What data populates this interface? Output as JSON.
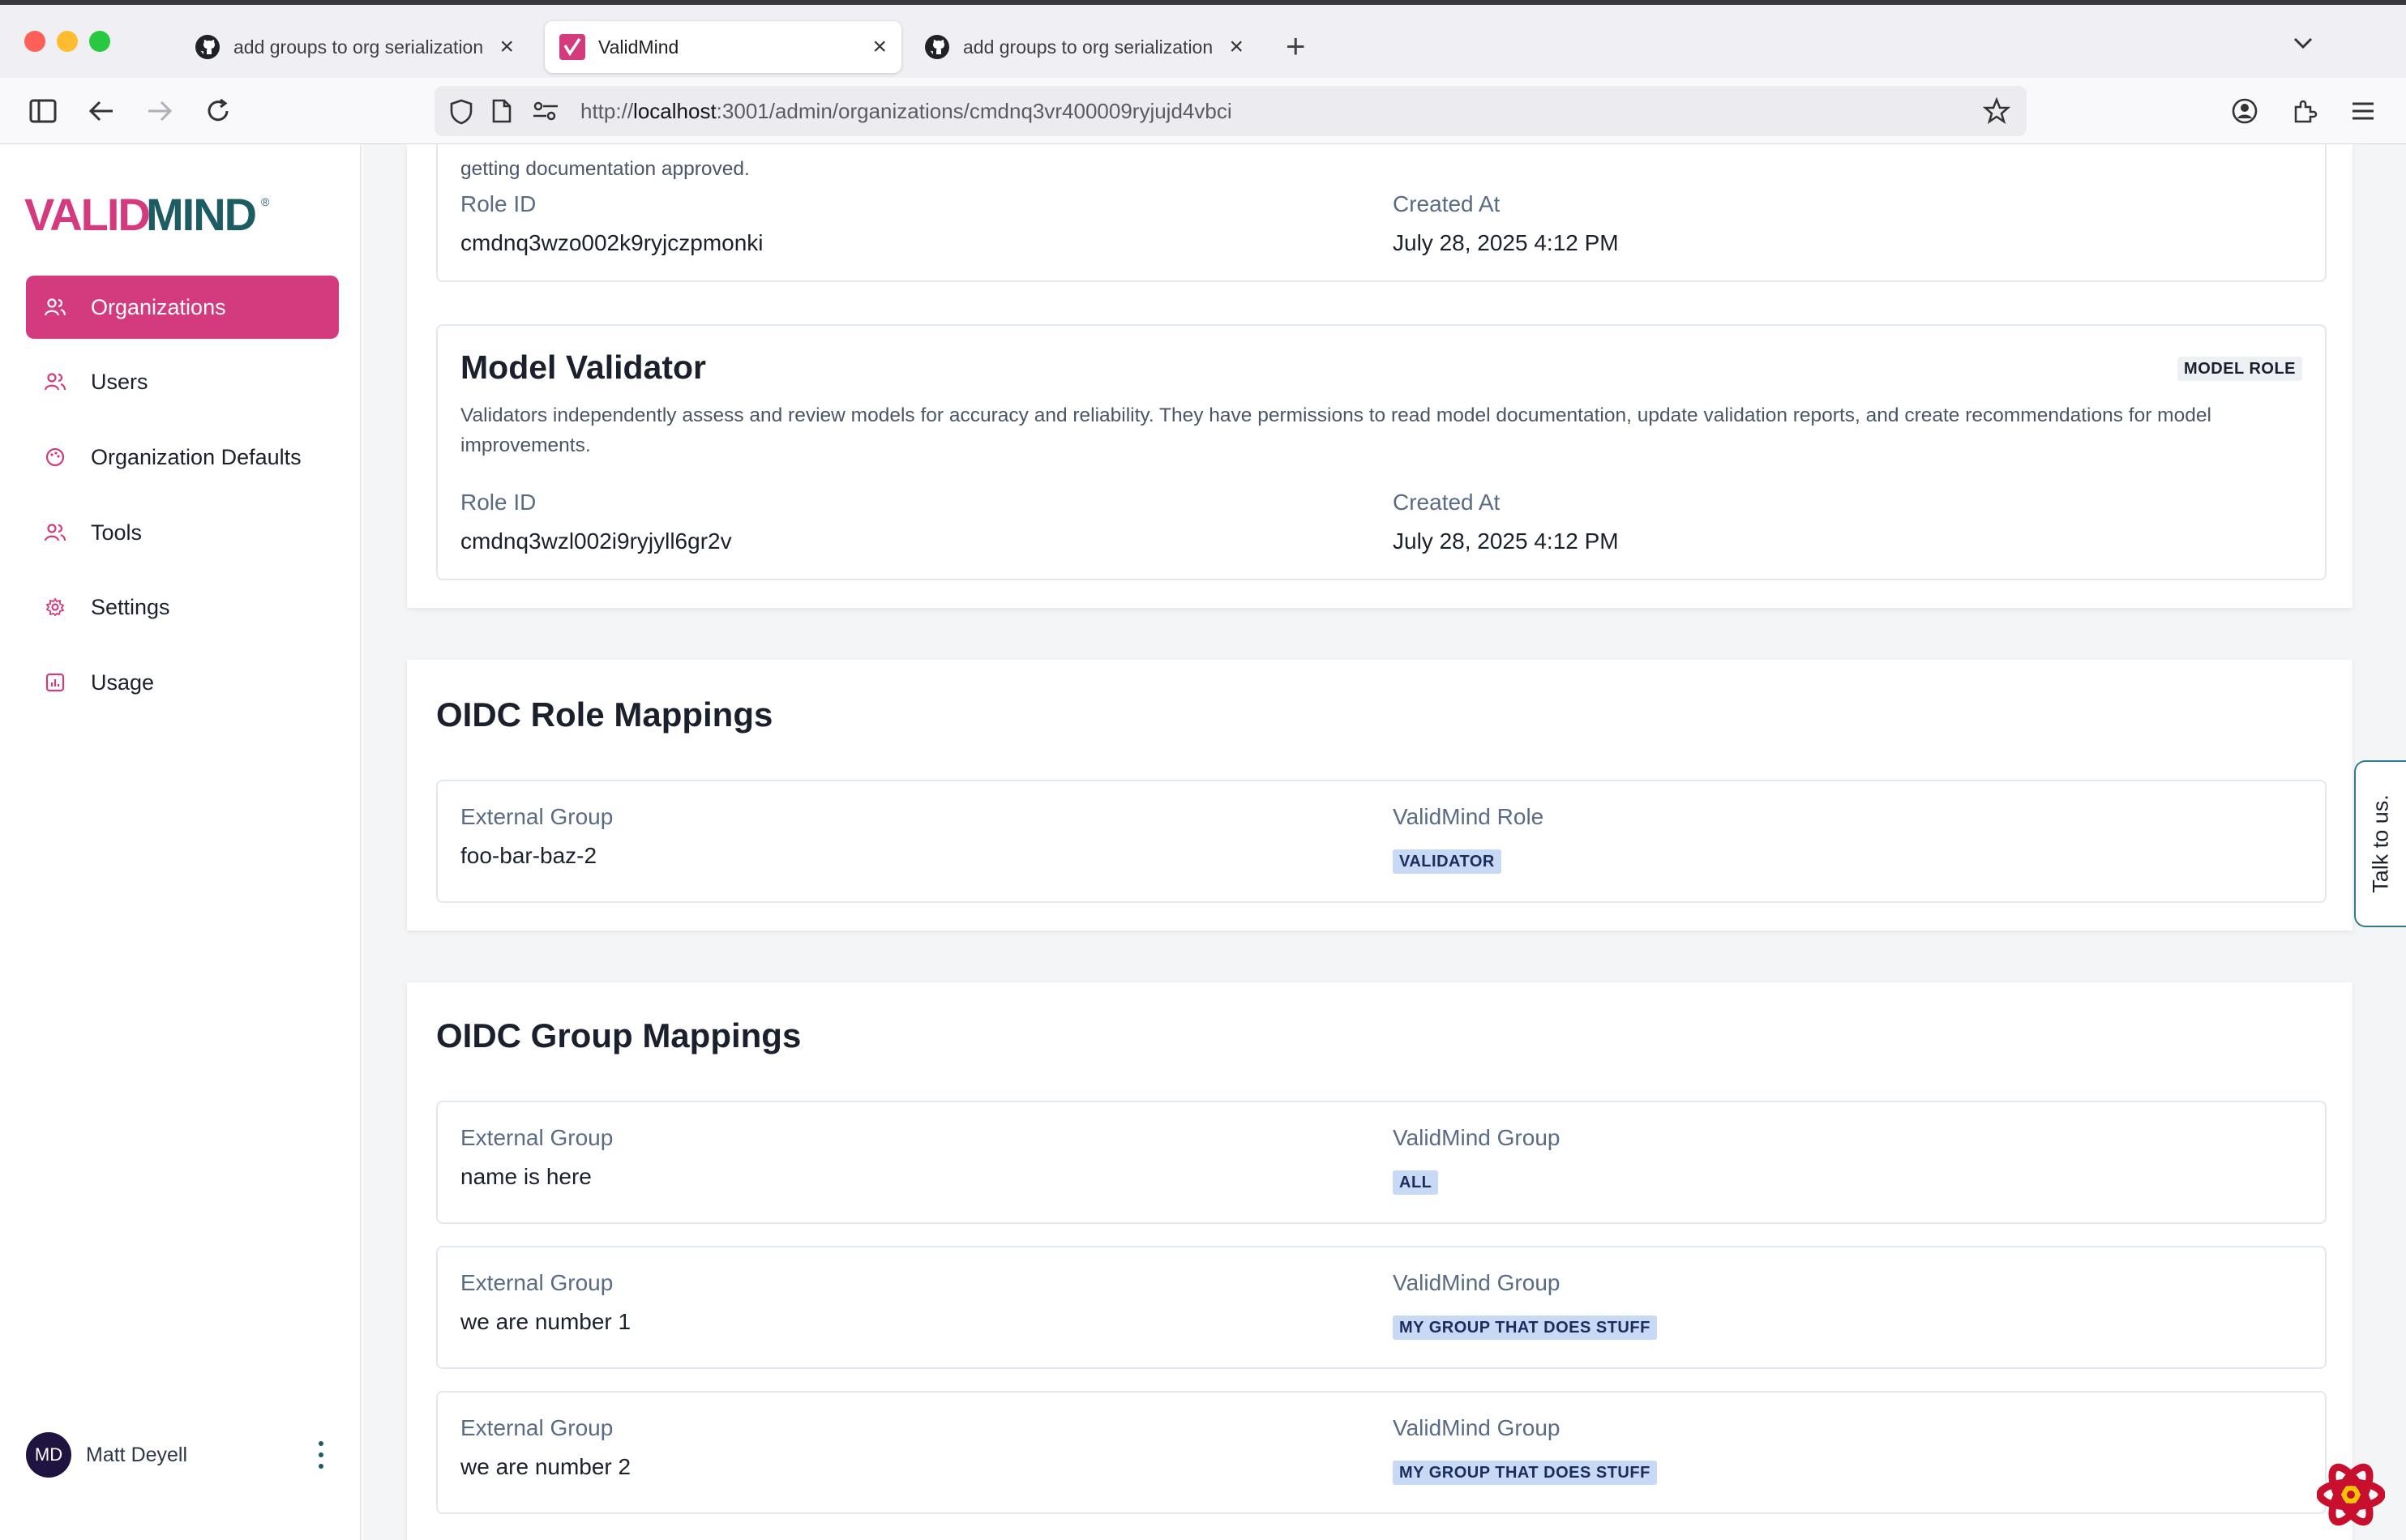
{
  "browser": {
    "tabs": [
      {
        "title": "add groups to org serialization by",
        "active": false
      },
      {
        "title": "ValidMind",
        "active": true
      },
      {
        "title": "add groups to org serialization by",
        "active": false
      }
    ],
    "url_scheme": "http://",
    "url_host": "localhost",
    "url_rest": ":3001/admin/organizations/cmdnq3vr400009ryjujd4vbci"
  },
  "brand": {
    "logo_text": "VALIDMIND",
    "accent": "#d43b7f",
    "teal": "#1d5c63"
  },
  "sidebar": {
    "items": [
      {
        "label": "Organizations",
        "icon": "users-icon",
        "active": true
      },
      {
        "label": "Users",
        "icon": "users-icon",
        "active": false
      },
      {
        "label": "Organization Defaults",
        "icon": "palette-icon",
        "active": false
      },
      {
        "label": "Tools",
        "icon": "users-icon",
        "active": false
      },
      {
        "label": "Settings",
        "icon": "gear-icon",
        "active": false
      },
      {
        "label": "Usage",
        "icon": "chart-icon",
        "active": false
      }
    ],
    "user": {
      "initials": "MD",
      "name": "Matt Deyell"
    }
  },
  "roles": {
    "partial_desc_tail": "getting documentation approved.",
    "first": {
      "role_id_label": "Role ID",
      "role_id": "cmdnq3wzo002k9ryjczpmonki",
      "created_label": "Created At",
      "created": "July 28, 2025 4:12 PM"
    },
    "second": {
      "title": "Model Validator",
      "badge": "MODEL ROLE",
      "description": "Validators independently assess and review models for accuracy and reliability. They have permissions to read model documentation, update validation reports, and create recommendations for model improvements.",
      "role_id_label": "Role ID",
      "role_id": "cmdnq3wzl002i9ryjyll6gr2v",
      "created_label": "Created At",
      "created": "July 28, 2025 4:12 PM"
    }
  },
  "oidc_roles": {
    "title": "OIDC Role Mappings",
    "rows": [
      {
        "ext_label": "External Group",
        "ext_value": "foo-bar-baz-2",
        "vm_label": "ValidMind Role",
        "vm_value": "VALIDATOR"
      }
    ]
  },
  "oidc_groups": {
    "title": "OIDC Group Mappings",
    "rows": [
      {
        "ext_label": "External Group",
        "ext_value": "name is here",
        "vm_label": "ValidMind Group",
        "vm_value": "ALL"
      },
      {
        "ext_label": "External Group",
        "ext_value": "we are number 1",
        "vm_label": "ValidMind Group",
        "vm_value": "MY GROUP THAT DOES STUFF"
      },
      {
        "ext_label": "External Group",
        "ext_value": "we are number 2",
        "vm_label": "ValidMind Group",
        "vm_value": "MY GROUP THAT DOES STUFF"
      }
    ]
  },
  "feedback_tab": "Talk to us."
}
